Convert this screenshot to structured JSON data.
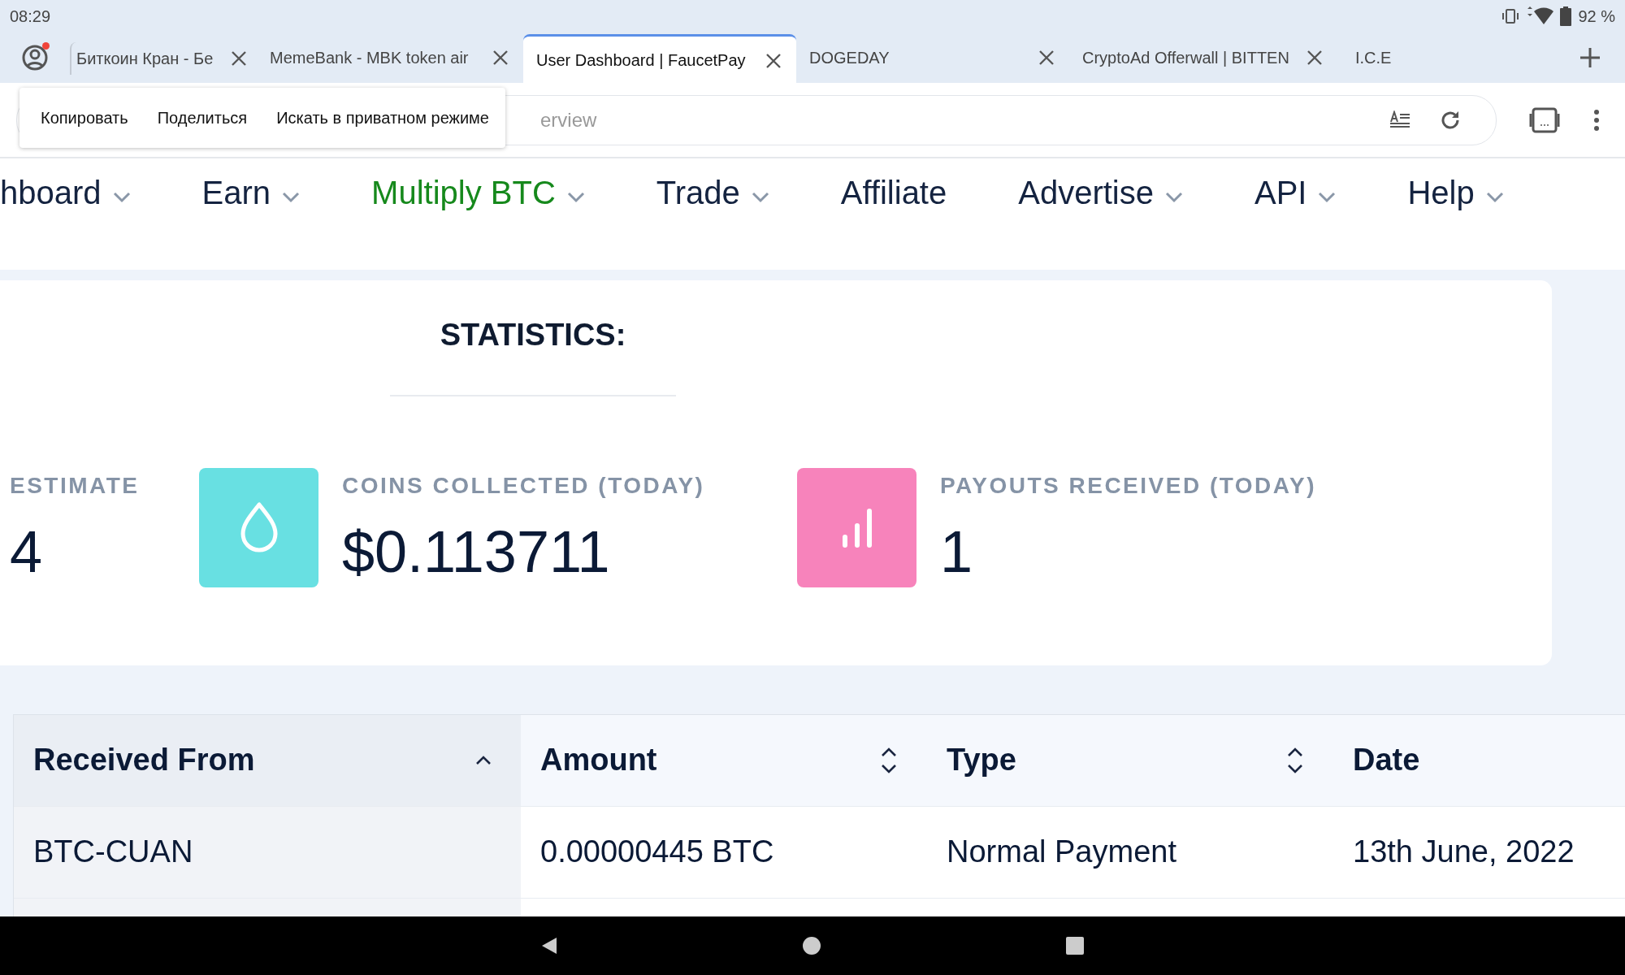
{
  "status_bar": {
    "time": "08:29",
    "battery": "92 %"
  },
  "tabs": [
    {
      "title": "Биткоин Кран - Бе",
      "selected": false,
      "closable": true
    },
    {
      "title": "MemeBank - MBK token air",
      "selected": false,
      "closable": true
    },
    {
      "title": "User Dashboard | FaucetPay",
      "selected": true,
      "closable": true
    },
    {
      "title": "DOGEDAY",
      "selected": false,
      "closable": true
    },
    {
      "title": "CryptoAd Offerwall | BITTEN",
      "selected": false,
      "closable": true
    },
    {
      "title": "I.C.E",
      "selected": false,
      "closable": false
    }
  ],
  "profile": {
    "has_notification": true
  },
  "address_bar": {
    "value": "erview"
  },
  "context_menu": {
    "items": [
      "Копировать",
      "Поделиться",
      "Искать в приватном режиме"
    ]
  },
  "nav": [
    {
      "label": "hboard",
      "selected": false,
      "dropdown": true
    },
    {
      "label": "Earn",
      "selected": false,
      "dropdown": true
    },
    {
      "label": "Multiply BTC",
      "selected": true,
      "dropdown": true
    },
    {
      "label": "Trade",
      "selected": false,
      "dropdown": true
    },
    {
      "label": "Affiliate",
      "selected": false,
      "dropdown": false
    },
    {
      "label": "Advertise",
      "selected": false,
      "dropdown": true
    },
    {
      "label": "API",
      "selected": false,
      "dropdown": true
    },
    {
      "label": "Help",
      "selected": false,
      "dropdown": true
    }
  ],
  "statistics": {
    "title": "STATISTICS:",
    "items": [
      {
        "label": "ESTIMATE",
        "value": "4",
        "kind": "plain"
      },
      {
        "label": "COINS COLLECTED (TODAY)",
        "value": "$0.113711",
        "kind": "drop",
        "color": "#68e0e2"
      },
      {
        "label": "PAYOUTS RECEIVED (TODAY)",
        "value": "1",
        "kind": "chart",
        "color": "#f783bb"
      }
    ]
  },
  "table": {
    "columns": [
      {
        "label": "Received From",
        "kind": "sorted"
      },
      {
        "label": "Amount",
        "kind": "sortable"
      },
      {
        "label": "Type",
        "kind": "sortable"
      },
      {
        "label": "Date",
        "kind": "plain"
      }
    ],
    "rows": [
      [
        "BTC-CUAN",
        "0.00000445 BTC",
        "Normal Payment",
        "13th June, 2022"
      ]
    ]
  }
}
